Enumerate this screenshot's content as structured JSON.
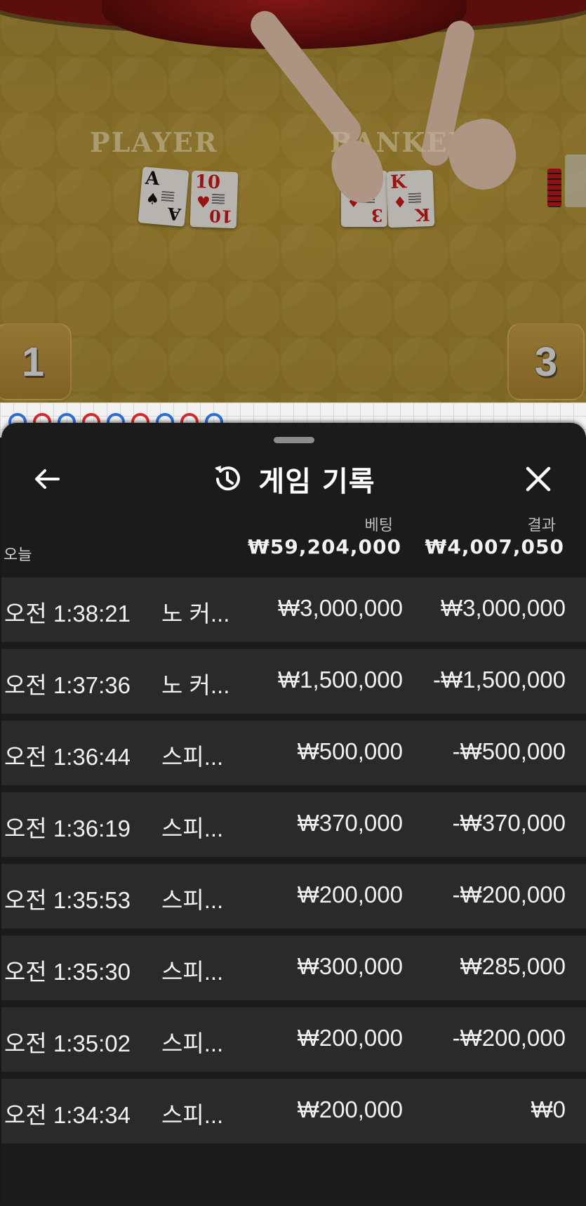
{
  "stage": {
    "player_label": "PLAYER",
    "banker_label": "BANKER",
    "seat_left": "1",
    "seat_right": "3",
    "player_cards": [
      {
        "rank": "A",
        "suit": "♠",
        "color": "black"
      },
      {
        "rank": "10",
        "suit": "♥",
        "color": "red"
      }
    ],
    "banker_cards": [
      {
        "rank": "3",
        "suit": "♦",
        "color": "red"
      },
      {
        "rank": "K",
        "suit": "♦",
        "color": "red"
      }
    ]
  },
  "roadmap": {
    "beads": [
      "b",
      "r",
      "b",
      "r",
      "b",
      "r",
      "b",
      "r",
      "b"
    ]
  },
  "panel": {
    "title": "게임 기록",
    "back_icon": "arrow-left-icon",
    "history_icon": "history-clock-icon",
    "close_icon": "close-icon",
    "col_bet": "베팅",
    "col_result": "결과",
    "today_label": "오늘",
    "sum_bet": "₩59,204,000",
    "sum_result": "₩4,007,050",
    "rows": [
      {
        "time": "오전 1:38:21",
        "game": "노 커...",
        "bet": "₩3,000,000",
        "result": "₩3,000,000"
      },
      {
        "time": "오전 1:37:36",
        "game": "노 커...",
        "bet": "₩1,500,000",
        "result": "-₩1,500,000"
      },
      {
        "time": "오전 1:36:44",
        "game": "스피...",
        "bet": "₩500,000",
        "result": "-₩500,000"
      },
      {
        "time": "오전 1:36:19",
        "game": "스피...",
        "bet": "₩370,000",
        "result": "-₩370,000"
      },
      {
        "time": "오전 1:35:53",
        "game": "스피...",
        "bet": "₩200,000",
        "result": "-₩200,000"
      },
      {
        "time": "오전 1:35:30",
        "game": "스피...",
        "bet": "₩300,000",
        "result": "₩285,000"
      },
      {
        "time": "오전 1:35:02",
        "game": "스피...",
        "bet": "₩200,000",
        "result": "-₩200,000"
      },
      {
        "time": "오전 1:34:34",
        "game": "스피...",
        "bet": "₩200,000",
        "result": "₩0"
      }
    ]
  }
}
